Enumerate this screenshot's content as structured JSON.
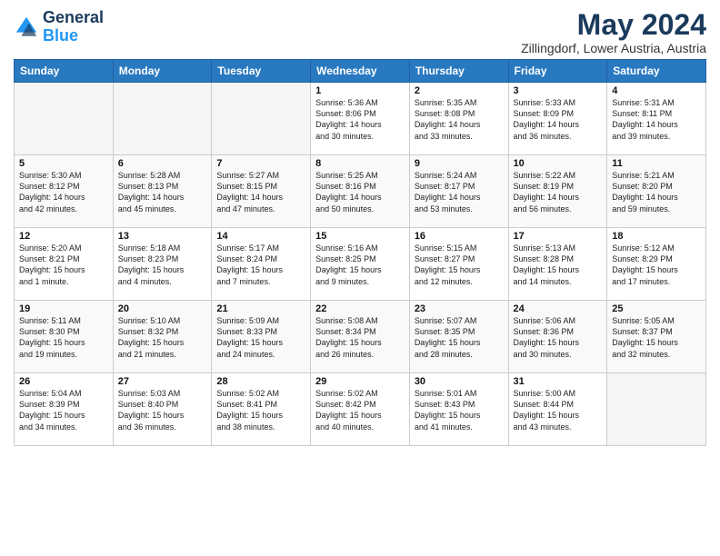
{
  "logo": {
    "line1": "General",
    "line2": "Blue"
  },
  "title": "May 2024",
  "subtitle": "Zillingdorf, Lower Austria, Austria",
  "days_of_week": [
    "Sunday",
    "Monday",
    "Tuesday",
    "Wednesday",
    "Thursday",
    "Friday",
    "Saturday"
  ],
  "weeks": [
    [
      {
        "day": "",
        "info": ""
      },
      {
        "day": "",
        "info": ""
      },
      {
        "day": "",
        "info": ""
      },
      {
        "day": "1",
        "info": "Sunrise: 5:36 AM\nSunset: 8:06 PM\nDaylight: 14 hours\nand 30 minutes."
      },
      {
        "day": "2",
        "info": "Sunrise: 5:35 AM\nSunset: 8:08 PM\nDaylight: 14 hours\nand 33 minutes."
      },
      {
        "day": "3",
        "info": "Sunrise: 5:33 AM\nSunset: 8:09 PM\nDaylight: 14 hours\nand 36 minutes."
      },
      {
        "day": "4",
        "info": "Sunrise: 5:31 AM\nSunset: 8:11 PM\nDaylight: 14 hours\nand 39 minutes."
      }
    ],
    [
      {
        "day": "5",
        "info": "Sunrise: 5:30 AM\nSunset: 8:12 PM\nDaylight: 14 hours\nand 42 minutes."
      },
      {
        "day": "6",
        "info": "Sunrise: 5:28 AM\nSunset: 8:13 PM\nDaylight: 14 hours\nand 45 minutes."
      },
      {
        "day": "7",
        "info": "Sunrise: 5:27 AM\nSunset: 8:15 PM\nDaylight: 14 hours\nand 47 minutes."
      },
      {
        "day": "8",
        "info": "Sunrise: 5:25 AM\nSunset: 8:16 PM\nDaylight: 14 hours\nand 50 minutes."
      },
      {
        "day": "9",
        "info": "Sunrise: 5:24 AM\nSunset: 8:17 PM\nDaylight: 14 hours\nand 53 minutes."
      },
      {
        "day": "10",
        "info": "Sunrise: 5:22 AM\nSunset: 8:19 PM\nDaylight: 14 hours\nand 56 minutes."
      },
      {
        "day": "11",
        "info": "Sunrise: 5:21 AM\nSunset: 8:20 PM\nDaylight: 14 hours\nand 59 minutes."
      }
    ],
    [
      {
        "day": "12",
        "info": "Sunrise: 5:20 AM\nSunset: 8:21 PM\nDaylight: 15 hours\nand 1 minute."
      },
      {
        "day": "13",
        "info": "Sunrise: 5:18 AM\nSunset: 8:23 PM\nDaylight: 15 hours\nand 4 minutes."
      },
      {
        "day": "14",
        "info": "Sunrise: 5:17 AM\nSunset: 8:24 PM\nDaylight: 15 hours\nand 7 minutes."
      },
      {
        "day": "15",
        "info": "Sunrise: 5:16 AM\nSunset: 8:25 PM\nDaylight: 15 hours\nand 9 minutes."
      },
      {
        "day": "16",
        "info": "Sunrise: 5:15 AM\nSunset: 8:27 PM\nDaylight: 15 hours\nand 12 minutes."
      },
      {
        "day": "17",
        "info": "Sunrise: 5:13 AM\nSunset: 8:28 PM\nDaylight: 15 hours\nand 14 minutes."
      },
      {
        "day": "18",
        "info": "Sunrise: 5:12 AM\nSunset: 8:29 PM\nDaylight: 15 hours\nand 17 minutes."
      }
    ],
    [
      {
        "day": "19",
        "info": "Sunrise: 5:11 AM\nSunset: 8:30 PM\nDaylight: 15 hours\nand 19 minutes."
      },
      {
        "day": "20",
        "info": "Sunrise: 5:10 AM\nSunset: 8:32 PM\nDaylight: 15 hours\nand 21 minutes."
      },
      {
        "day": "21",
        "info": "Sunrise: 5:09 AM\nSunset: 8:33 PM\nDaylight: 15 hours\nand 24 minutes."
      },
      {
        "day": "22",
        "info": "Sunrise: 5:08 AM\nSunset: 8:34 PM\nDaylight: 15 hours\nand 26 minutes."
      },
      {
        "day": "23",
        "info": "Sunrise: 5:07 AM\nSunset: 8:35 PM\nDaylight: 15 hours\nand 28 minutes."
      },
      {
        "day": "24",
        "info": "Sunrise: 5:06 AM\nSunset: 8:36 PM\nDaylight: 15 hours\nand 30 minutes."
      },
      {
        "day": "25",
        "info": "Sunrise: 5:05 AM\nSunset: 8:37 PM\nDaylight: 15 hours\nand 32 minutes."
      }
    ],
    [
      {
        "day": "26",
        "info": "Sunrise: 5:04 AM\nSunset: 8:39 PM\nDaylight: 15 hours\nand 34 minutes."
      },
      {
        "day": "27",
        "info": "Sunrise: 5:03 AM\nSunset: 8:40 PM\nDaylight: 15 hours\nand 36 minutes."
      },
      {
        "day": "28",
        "info": "Sunrise: 5:02 AM\nSunset: 8:41 PM\nDaylight: 15 hours\nand 38 minutes."
      },
      {
        "day": "29",
        "info": "Sunrise: 5:02 AM\nSunset: 8:42 PM\nDaylight: 15 hours\nand 40 minutes."
      },
      {
        "day": "30",
        "info": "Sunrise: 5:01 AM\nSunset: 8:43 PM\nDaylight: 15 hours\nand 41 minutes."
      },
      {
        "day": "31",
        "info": "Sunrise: 5:00 AM\nSunset: 8:44 PM\nDaylight: 15 hours\nand 43 minutes."
      },
      {
        "day": "",
        "info": ""
      }
    ]
  ]
}
